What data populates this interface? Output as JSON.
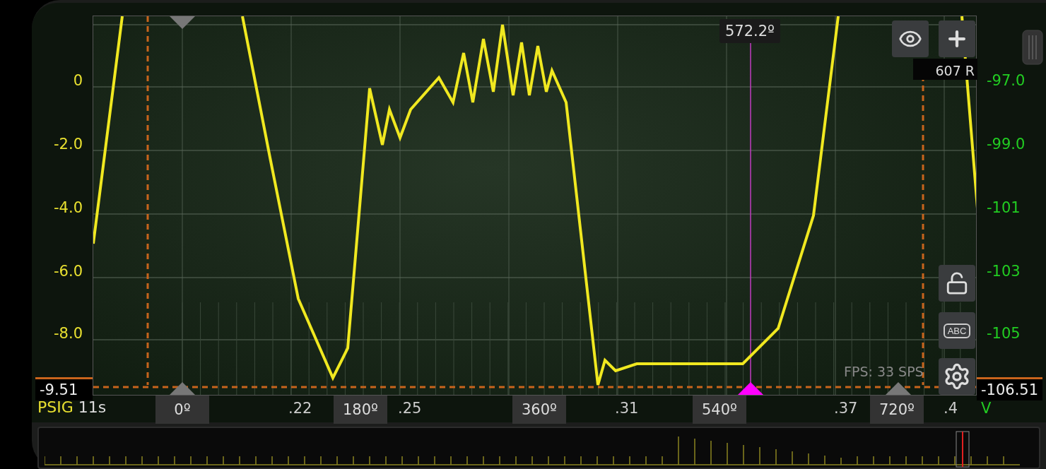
{
  "trace": {
    "name": "PSIG",
    "duration": "11s"
  },
  "left_axis": {
    "ticks": [
      "0",
      "-2.0",
      "-4.0",
      "-6.0",
      "-8.0"
    ],
    "trigger": "-9.51"
  },
  "right_axis": {
    "ticks": [
      "-97.0",
      "-99.0",
      "-101",
      "-103",
      "-105"
    ],
    "trigger": "-106.51",
    "unit": "V"
  },
  "x_axis": {
    "ticks": [
      ".22",
      ".25",
      ".31",
      ".37",
      ".4"
    ]
  },
  "degree_markers": [
    {
      "label": "0º"
    },
    {
      "label": "180º"
    },
    {
      "label": "360º"
    },
    {
      "label": "540º"
    },
    {
      "label": "720º"
    }
  ],
  "cursor": {
    "label": "572.2º"
  },
  "rpm_badge": "607 R",
  "status": "FPS: 33  SPS",
  "tools": [
    {
      "kind": "eye"
    },
    {
      "kind": "plus"
    },
    {
      "kind": "lock"
    },
    {
      "kind": "abc",
      "label": "ABC"
    },
    {
      "kind": "gear"
    }
  ]
}
